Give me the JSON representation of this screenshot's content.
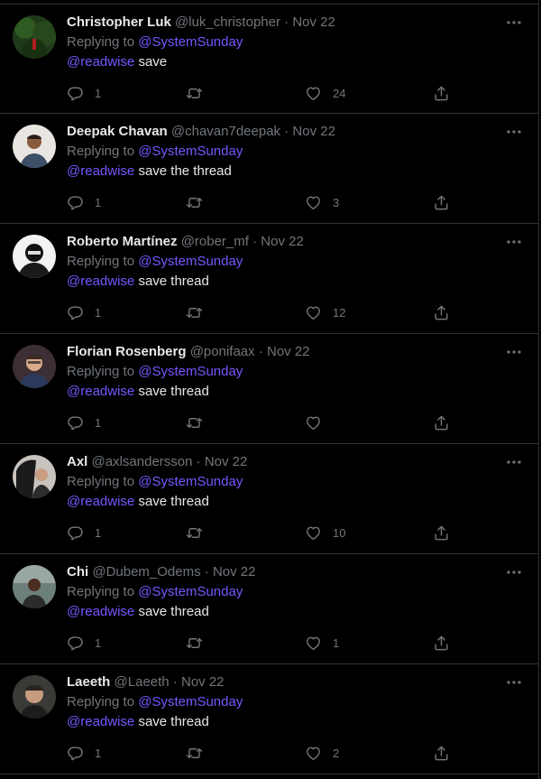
{
  "replying_label": "Replying to",
  "reply_target": "@SystemSunday",
  "mention": "@readwise",
  "colors": {
    "background": "#000000",
    "text": "#e7e9ea",
    "muted": "#71767b",
    "link": "#7856ff",
    "divider": "#2f3336"
  },
  "tweets": [
    {
      "name": "Christopher Luk",
      "handle": "@luk_christopher",
      "separator": "·",
      "date": "Nov 22",
      "text": "save",
      "replies": "1",
      "retweets": "",
      "likes": "24",
      "avatar_icon": "avatar-photo-icon"
    },
    {
      "name": "Deepak Chavan",
      "handle": "@chavan7deepak",
      "separator": "·",
      "date": "Nov 22",
      "text": "save the thread",
      "replies": "1",
      "retweets": "",
      "likes": "3",
      "avatar_icon": "avatar-photo-icon"
    },
    {
      "name": "Roberto Martínez",
      "handle": "@rober_mf",
      "separator": "·",
      "date": "Nov 22",
      "text": "save thread",
      "replies": "1",
      "retweets": "",
      "likes": "12",
      "avatar_icon": "avatar-photo-icon"
    },
    {
      "name": "Florian Rosenberg",
      "handle": "@ponifaax",
      "separator": "·",
      "date": "Nov 22",
      "text": "save thread",
      "replies": "1",
      "retweets": "",
      "likes": "",
      "avatar_icon": "avatar-photo-icon"
    },
    {
      "name": "Axl",
      "handle": "@axlsandersson",
      "separator": "·",
      "date": "Nov 22",
      "text": "save thread",
      "replies": "1",
      "retweets": "",
      "likes": "10",
      "avatar_icon": "avatar-photo-icon"
    },
    {
      "name": "Chi",
      "handle": "@Dubem_Odems",
      "separator": "·",
      "date": "Nov 22",
      "text": "save thread",
      "replies": "1",
      "retweets": "",
      "likes": "1",
      "avatar_icon": "avatar-photo-icon"
    },
    {
      "name": "Laeeth",
      "handle": "@Laeeth",
      "separator": "·",
      "date": "Nov 22",
      "text": "save thread",
      "replies": "1",
      "retweets": "",
      "likes": "2",
      "avatar_icon": "avatar-photo-icon"
    }
  ]
}
